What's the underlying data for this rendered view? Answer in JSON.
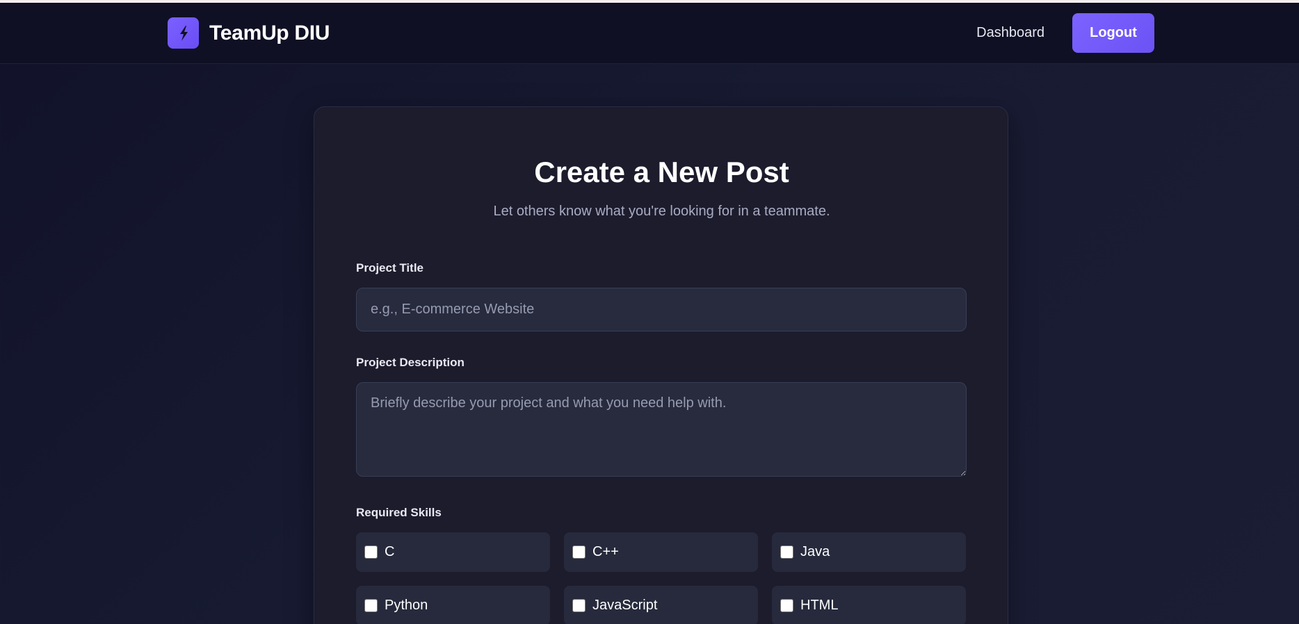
{
  "header": {
    "brand_name": "TeamUp DIU",
    "nav_dashboard": "Dashboard",
    "logout_label": "Logout"
  },
  "form": {
    "title": "Create a New Post",
    "subtitle": "Let others know what you're looking for in a teammate.",
    "project_title": {
      "label": "Project Title",
      "value": "",
      "placeholder": "e.g., E-commerce Website"
    },
    "project_description": {
      "label": "Project Description",
      "value": "",
      "placeholder": "Briefly describe your project and what you need help with."
    },
    "skills": {
      "label": "Required Skills",
      "items": [
        {
          "label": "C",
          "checked": false
        },
        {
          "label": "C++",
          "checked": false
        },
        {
          "label": "Java",
          "checked": false
        },
        {
          "label": "Python",
          "checked": false
        },
        {
          "label": "JavaScript",
          "checked": false
        },
        {
          "label": "HTML",
          "checked": false
        }
      ]
    }
  },
  "colors": {
    "accent": "#7c63ff",
    "nav_background": "#0f1024",
    "card_background": "#1c1c2d",
    "input_background": "#272b3d"
  },
  "icons": {
    "brand_logo": "lightning-bolt-icon"
  }
}
